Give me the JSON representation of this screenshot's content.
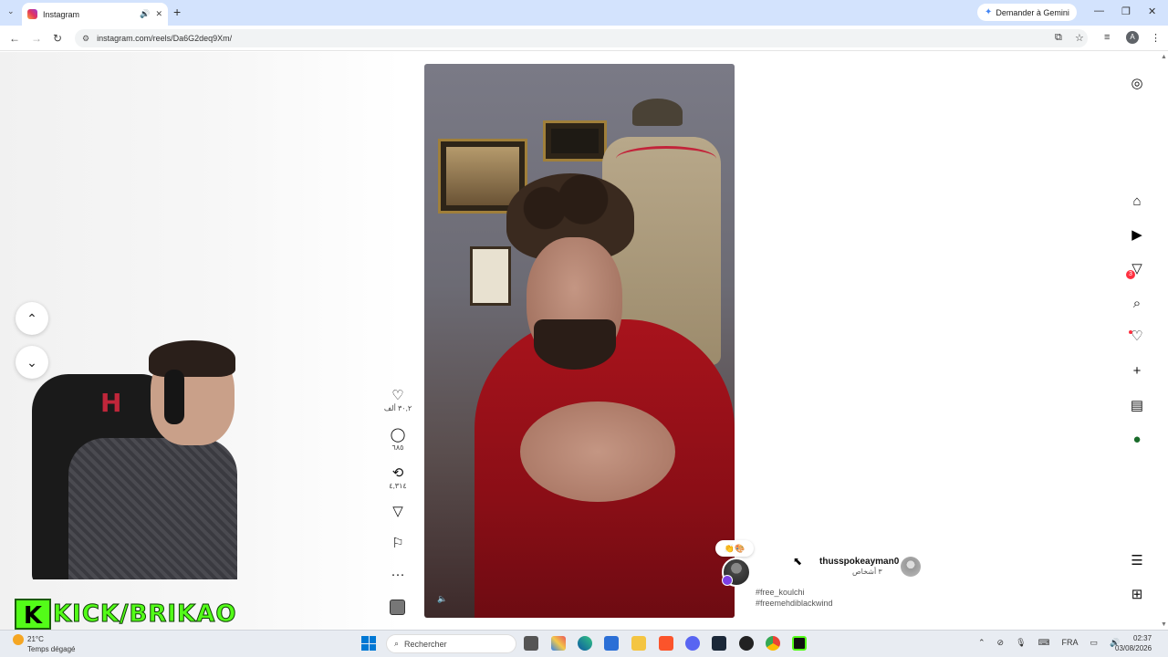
{
  "browser": {
    "tab_title": "Instagram",
    "new_tab_icon": "+",
    "gemini_label": "Demander à Gemini",
    "url": "instagram.com/reels/Da6G2deq9Xm/"
  },
  "page": {
    "owner_reactions": "👏🎨",
    "actions": {
      "likes": "٣٠,٢ ألف",
      "comments": "٦٨٥",
      "reposts": "٤,٣١٤"
    },
    "user": {
      "username": "thusspokeayman0",
      "subtitle": "٣ أشخاص"
    },
    "hashtags": [
      "#free_koulchi",
      "#freemehdiblackwind"
    ],
    "overlay_text": "KICK/BRIKAO",
    "overlay_logo": "K"
  },
  "right_nav": {
    "messages_badge": "3"
  },
  "taskbar": {
    "weather_temp": "21°C",
    "weather_desc": "Temps dégagé",
    "search_placeholder": "Rechercher",
    "lang": "FRA",
    "time": "02:37",
    "date": "03/08/2026"
  },
  "colors": {
    "instagram_red": "#ff3040",
    "kick_green": "#53fc18",
    "tabbar": "#d3e3fd"
  }
}
